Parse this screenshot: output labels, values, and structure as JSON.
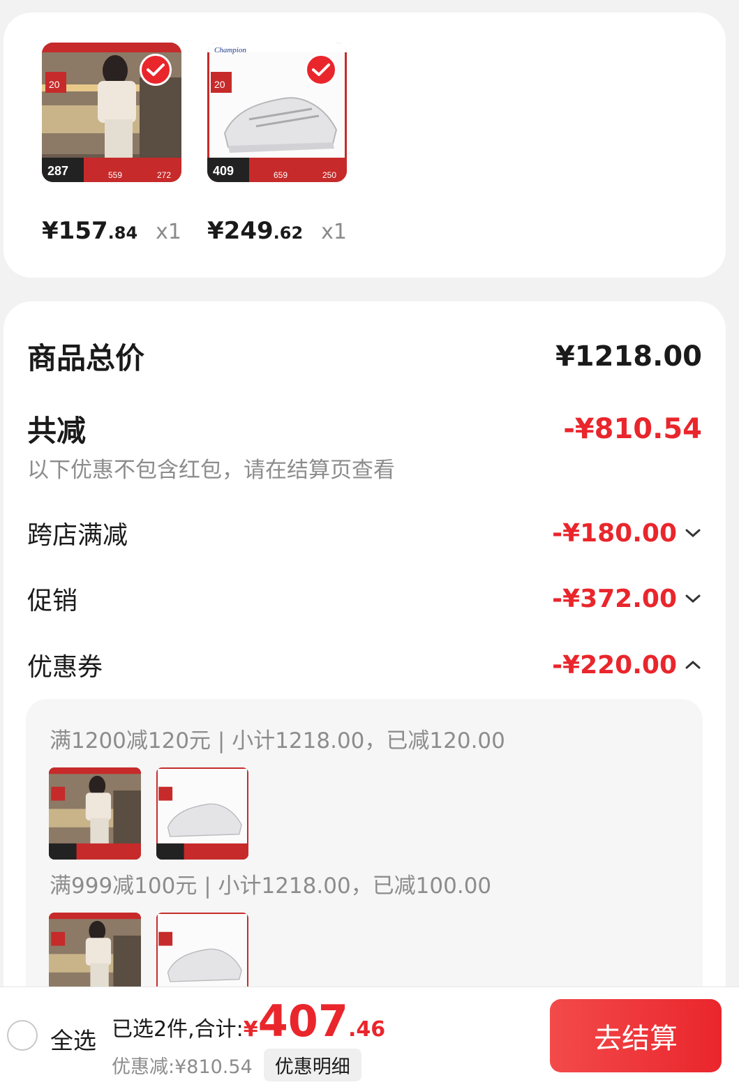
{
  "products": [
    {
      "price_int": "¥157",
      "price_dec": ".84",
      "qty": "x1",
      "thumb_price": "287",
      "thumb_badge": "20",
      "thumb_a": "559",
      "thumb_b": "272",
      "selected": true
    },
    {
      "price_int": "¥249",
      "price_dec": ".62",
      "qty": "x1",
      "thumb_price": "409",
      "thumb_badge": "20",
      "thumb_a": "659",
      "thumb_b": "250",
      "selected": true
    }
  ],
  "summary": {
    "total_label": "商品总价",
    "total_amount": "¥1218.00",
    "discount_label": "共减",
    "discount_amount": "-¥810.54",
    "note": "以下优惠不包含红包，请在结算页查看",
    "items": [
      {
        "label": "跨店满减",
        "amount": "-¥180.00"
      },
      {
        "label": "促销",
        "amount": "-¥372.00"
      },
      {
        "label": "优惠券",
        "amount": "-¥220.00"
      }
    ],
    "coupons": [
      {
        "text": "满1200减120元 | 小计1218.00，已减120.00"
      },
      {
        "text": "满999减100元 | 小计1218.00，已减100.00"
      }
    ]
  },
  "bottom": {
    "select_all": "全选",
    "total_label": "已选2件,合计:",
    "currency": "¥",
    "total_int": "407",
    "total_dec": ".46",
    "discount_text": "优惠减:¥810.54",
    "detail_button": "优惠明细",
    "checkout_button": "去结算"
  },
  "colors": {
    "accent": "#e9262c"
  }
}
